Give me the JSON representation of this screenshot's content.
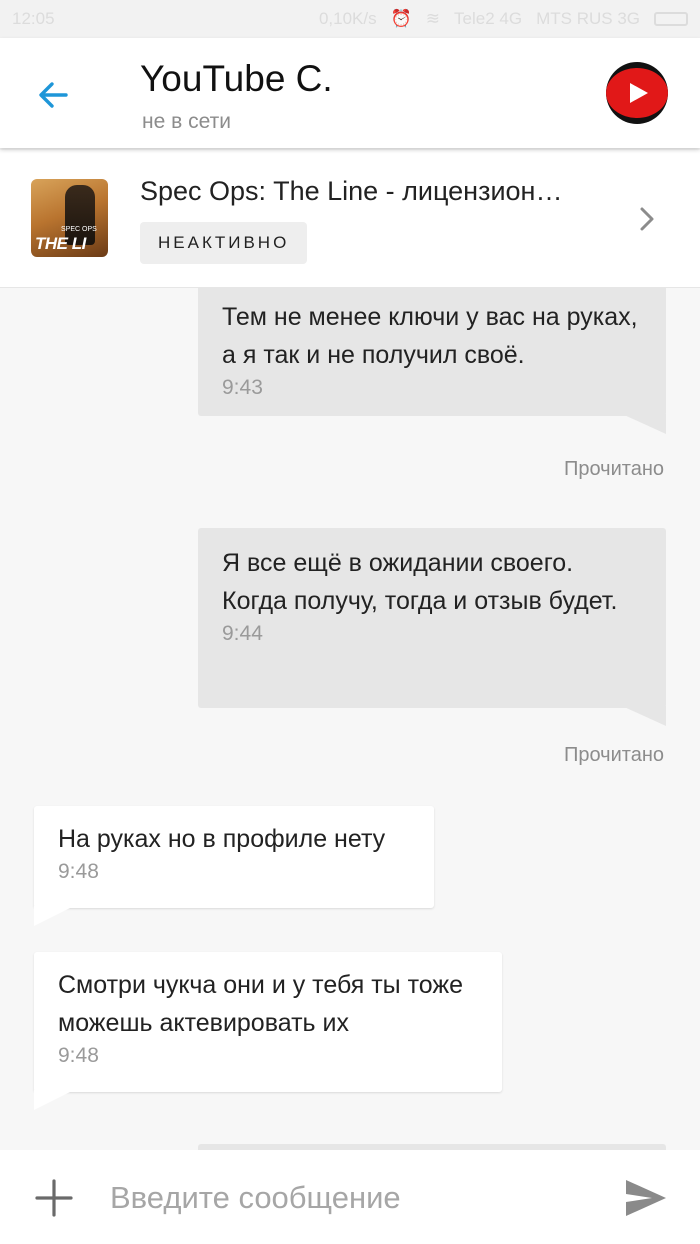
{
  "status_bar": {
    "time": "12:05",
    "network_speed": "0,10K/s",
    "carrier_1": "Tele2 4G",
    "carrier_2": "MTS RUS 3G"
  },
  "header": {
    "contact_name": "YouTube C.",
    "contact_status": "не в сети"
  },
  "product": {
    "title": "Spec Ops: The Line - лицензион…",
    "badge": "НЕАКТИВНО",
    "thumb_logo": "THE LI",
    "thumb_small": "SPEC OPS"
  },
  "messages": [
    {
      "direction": "out",
      "text": "Тем не менее ключи у вас на руках, а я так и не получил своё.",
      "time": "9:43",
      "receipt": "Прочитано"
    },
    {
      "direction": "out",
      "text": "Я все ещё в ожидании своего. Когда получу, тогда и отзыв будет.",
      "time": "9:44",
      "receipt": "Прочитано"
    },
    {
      "direction": "in",
      "text": "На руках но в профиле нету",
      "time": "9:48"
    },
    {
      "direction": "in",
      "text": "Смотри чукча они и у тебя ты тоже можешь актевировать их",
      "time": "9:48"
    }
  ],
  "composer": {
    "placeholder": "Введите сообщение",
    "value": ""
  },
  "colors": {
    "accent": "#1e96d8",
    "outgoing_bubble": "#e6e6e6",
    "incoming_bubble": "#ffffff",
    "background": "#f7f7f7",
    "youtube_red": "#e11818"
  }
}
